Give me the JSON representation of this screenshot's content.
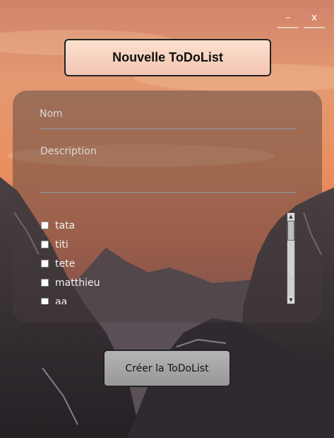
{
  "window": {
    "minimize_label": "–",
    "close_label": "x"
  },
  "header": {
    "title": "Nouvelle ToDoList"
  },
  "form": {
    "name_placeholder": "Nom",
    "description_placeholder": "Description"
  },
  "users": {
    "items": [
      {
        "label": "tata",
        "checked": false
      },
      {
        "label": "titi",
        "checked": false
      },
      {
        "label": "tete",
        "checked": false
      },
      {
        "label": "matthieu",
        "checked": false
      },
      {
        "label": "aa",
        "checked": false
      }
    ]
  },
  "actions": {
    "create_label": "Créer la ToDoList"
  },
  "colors": {
    "sky_top": "#d88d6c",
    "sky_mid": "#ec8a60",
    "mountain_dark": "#333038",
    "panel": "#4a3e3e",
    "title_button": "#f5cdbb",
    "create_button": "#a9a9a9"
  }
}
